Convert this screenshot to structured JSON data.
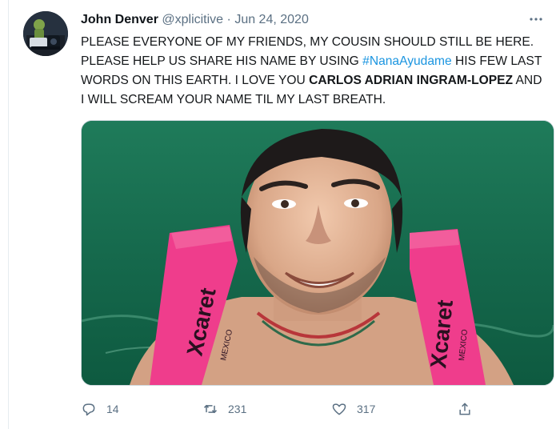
{
  "tweet": {
    "author_name": "John Denver",
    "handle": "@xplicitive",
    "separator": "·",
    "date": "Jun 24, 2020",
    "more_icon": "more-horizontal-icon",
    "text": {
      "part1": "PLEASE EVERYONE OF MY FRIENDS, MY COUSIN SHOULD STILL BE HERE. PLEASE HELP US SHARE HIS NAME BY USING ",
      "hashtag": "#NanaAyudame",
      "part2": " HIS FEW LAST WORDS ON THIS EARTH. I LOVE YOU ",
      "bold_name": "CARLOS ADRIAN INGRAM-LOPEZ",
      "part3": " AND I WILL SCREAM YOUR NAME TIL MY LAST BREATH."
    },
    "media": {
      "strap_text": "Xcaret MEXICO"
    },
    "actions": {
      "reply_count": "14",
      "retweet_count": "231",
      "like_count": "317"
    }
  },
  "colors": {
    "text": "#0f1419",
    "secondary": "#5b7083",
    "link": "#1b95e0",
    "photo_green": "#166b4f",
    "vest_pink": "#ef3d8c"
  }
}
